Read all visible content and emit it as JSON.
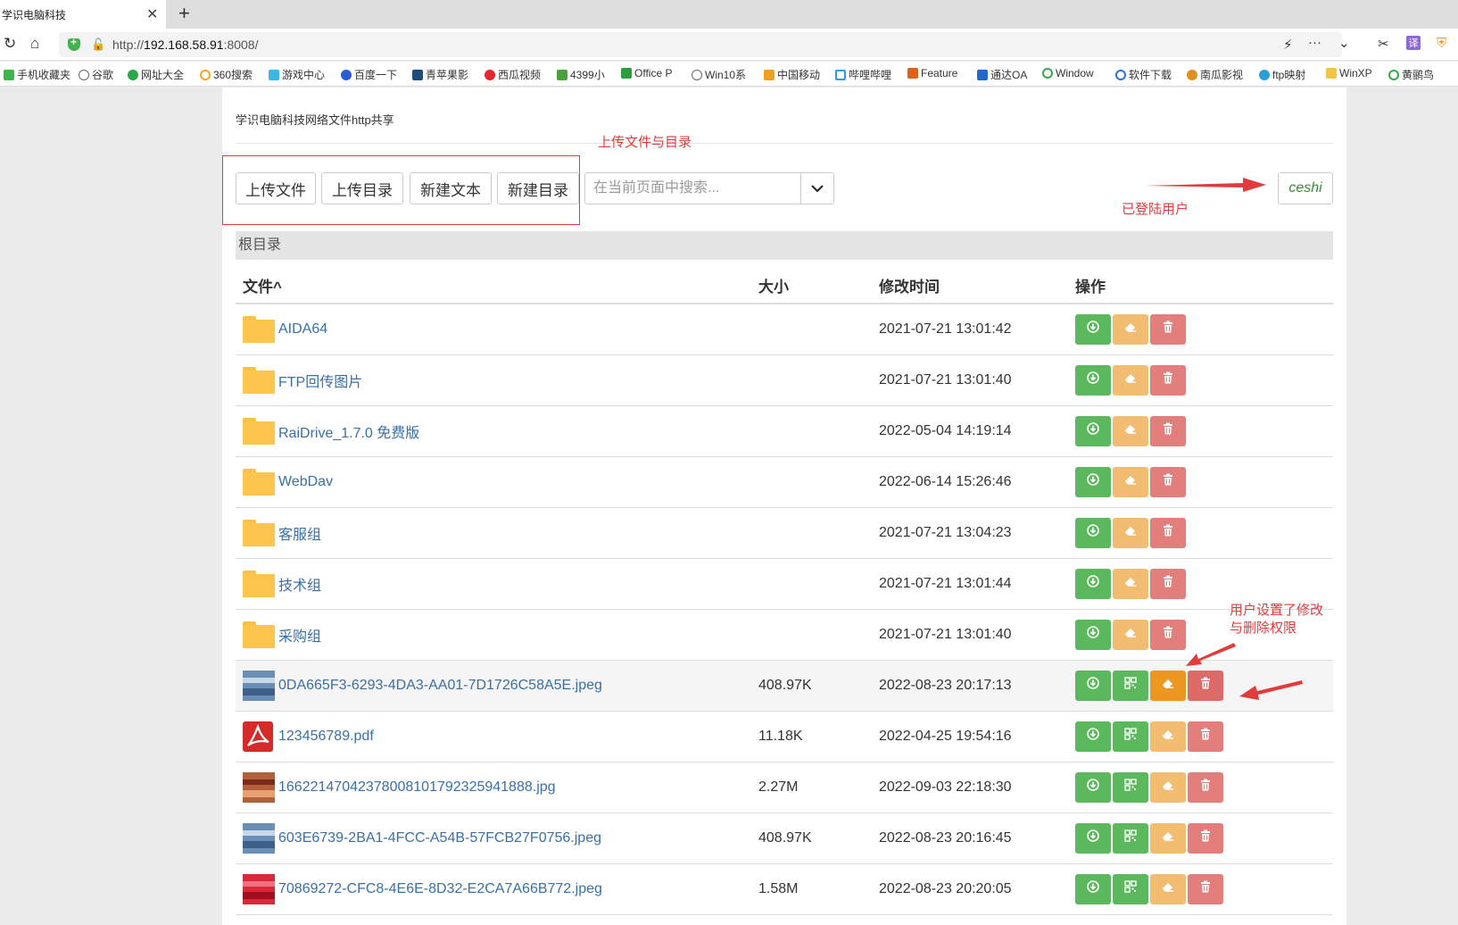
{
  "browser": {
    "tab_title": "学识电脑科技",
    "url_prefix": "http://",
    "url_host": "192.168.58.91",
    "url_suffix": ":8008/",
    "bookmarks": [
      "手机收藏夹",
      "谷歌",
      "网址大全",
      "360搜索",
      "游戏中心",
      "百度一下",
      "青苹果影",
      "西瓜视频",
      "4399小",
      "Office P",
      "Win10系",
      "中国移动",
      "哔哩哔哩",
      "Feature",
      "通达OA",
      "Window",
      "软件下载",
      "南瓜影视",
      "ftp映射",
      "WinXP",
      "黄鹂鸟"
    ]
  },
  "header": {
    "site_title": "学识电脑科技网络文件http共享"
  },
  "toolbar": {
    "upload_file": "上传文件",
    "upload_dir": "上传目录",
    "new_text": "新建文本",
    "new_dir": "新建目录",
    "search_placeholder": "在当前页面中搜索...",
    "user": "ceshi"
  },
  "annotations": {
    "upload_note": "上传文件与目录",
    "user_note": "已登陆用户",
    "perm_note_line1": "用户设置了修改",
    "perm_note_line2": "与删除权限",
    "color": "#e23b3b"
  },
  "breadcrumb": "根目录",
  "table": {
    "headers": [
      "文件^",
      "大小",
      "修改时间",
      "操作"
    ],
    "rows": [
      {
        "name": "AIDA64",
        "type": "folder",
        "size": "",
        "mtime": "2021-07-21 13:01:42"
      },
      {
        "name": "FTP回传图片",
        "type": "folder",
        "size": "",
        "mtime": "2021-07-21 13:01:40"
      },
      {
        "name": "RaiDrive_1.7.0 免费版",
        "type": "folder",
        "size": "",
        "mtime": "2022-05-04 14:19:14"
      },
      {
        "name": "WebDav",
        "type": "folder",
        "size": "",
        "mtime": "2022-06-14 15:26:46"
      },
      {
        "name": "客服组",
        "type": "folder",
        "size": "",
        "mtime": "2021-07-21 13:04:23"
      },
      {
        "name": "技术组",
        "type": "folder",
        "size": "",
        "mtime": "2021-07-21 13:01:44"
      },
      {
        "name": "采购组",
        "type": "folder",
        "size": "",
        "mtime": "2021-07-21 13:01:40"
      },
      {
        "name": "0DA665F3-6293-4DA3-AA01-7D1726C58A5E.jpeg",
        "type": "image",
        "size": "408.97K",
        "mtime": "2022-08-23 20:17:13"
      },
      {
        "name": "123456789.pdf",
        "type": "pdf",
        "size": "11.18K",
        "mtime": "2022-04-25 19:54:16"
      },
      {
        "name": "1662214704237800810179232594188​8.jpg",
        "type": "image",
        "size": "2.27M",
        "mtime": "2022-09-03 22:18:30"
      },
      {
        "name": "603E6739-2BA1-4FCC-A54B-57FCB27F0756.jpeg",
        "type": "image",
        "size": "408.97K",
        "mtime": "2022-08-23 20:16:45"
      },
      {
        "name": "70869272-CFC8-4E6E-8D32-E2CA7A66B772.jpeg",
        "type": "image",
        "size": "1.58M",
        "mtime": "2022-08-23 20:20:05"
      }
    ]
  }
}
